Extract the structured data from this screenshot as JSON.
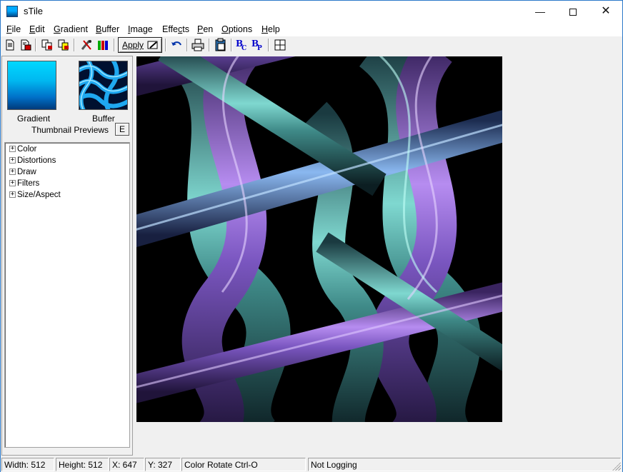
{
  "window": {
    "title": "sTile",
    "minimize": "—",
    "close": "✕"
  },
  "menu": [
    {
      "pre": "",
      "acc": "F",
      "post": "ile"
    },
    {
      "pre": "",
      "acc": "E",
      "post": "dit"
    },
    {
      "pre": "",
      "acc": "G",
      "post": "radient"
    },
    {
      "pre": "",
      "acc": "B",
      "post": "uffer"
    },
    {
      "pre": "",
      "acc": "I",
      "post": "mage"
    },
    {
      "pre": "Effe",
      "acc": "c",
      "post": "ts"
    },
    {
      "pre": "",
      "acc": "P",
      "post": "en"
    },
    {
      "pre": "",
      "acc": "O",
      "post": "ptions"
    },
    {
      "pre": "",
      "acc": "H",
      "post": "elp"
    }
  ],
  "toolbar": {
    "apply_label": "Apply"
  },
  "thumbnails": {
    "gradient_label": "Gradient",
    "buffer_label": "Buffer",
    "caption": "Thumbnail Previews",
    "edit_button": "E"
  },
  "tree": [
    "Color",
    "Distortions",
    "Draw",
    "Filters",
    "Size/Aspect"
  ],
  "status": {
    "width": "Width: 512",
    "height": "Height: 512",
    "x": "X: 647",
    "y": "Y: 327",
    "hint": "Color Rotate Ctrl-O",
    "logging": "Not Logging"
  },
  "colors": {
    "accent": "#2b79c9",
    "purple": "#9a6fd6",
    "teal": "#5fb8b0",
    "blue": "#6aa8e8"
  }
}
